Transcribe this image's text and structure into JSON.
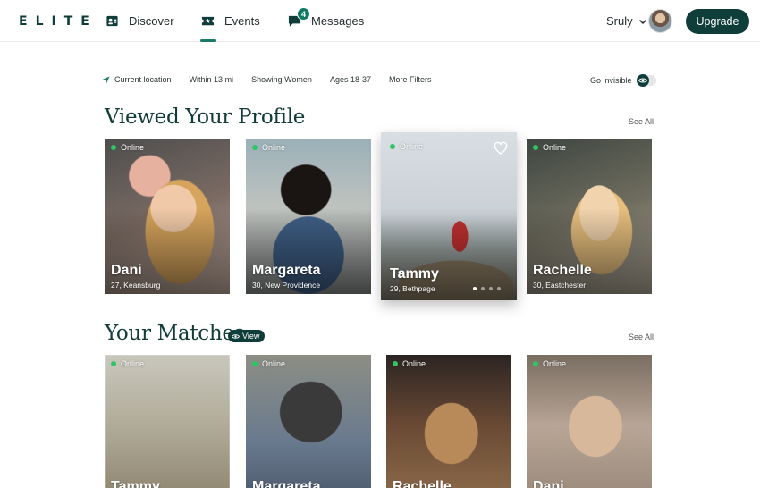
{
  "brand": {
    "logo": "ELITE"
  },
  "nav": {
    "discover": "Discover",
    "events": "Events",
    "messages": "Messages",
    "messages_badge": "4",
    "user_name": "Sruly",
    "upgrade": "Upgrade"
  },
  "filters": {
    "items": [
      "Current location",
      "Within 13 mi",
      "Showing Women",
      "Ages 18-37",
      "More Filters"
    ],
    "go_invisible": "Go invisible"
  },
  "viewed": {
    "title": "Viewed Your Profile",
    "see_all": "See All",
    "cards": [
      {
        "status": "Online",
        "name": "Dani",
        "meta": "27, Keansburg"
      },
      {
        "status": "Online",
        "name": "Margareta",
        "meta": "30, New Providence"
      },
      {
        "status": "Online",
        "name": "Tammy",
        "meta": "29, Bethpage"
      },
      {
        "status": "Online",
        "name": "Rachelle",
        "meta": "30, Eastchester"
      }
    ]
  },
  "matches": {
    "title": "Your Matches",
    "view": "View",
    "see_all": "See All",
    "cards": [
      {
        "status": "Online",
        "name": "Tammy"
      },
      {
        "status": "Online",
        "name": "Margareta"
      },
      {
        "status": "Online",
        "name": "Rachelle"
      },
      {
        "status": "Online",
        "name": "Dani"
      }
    ]
  },
  "colors": {
    "brand_dark": "#0f3d3a",
    "accent": "#1a7a66",
    "online": "#2fc465"
  },
  "icons": {
    "discover": "id-card-icon",
    "events": "ticket-star-icon",
    "messages": "chat-bubble-icon",
    "location": "location-arrow-icon",
    "invisible": "eye-icon",
    "favorite": "heart-icon",
    "user_menu": "chevron-down-icon"
  }
}
